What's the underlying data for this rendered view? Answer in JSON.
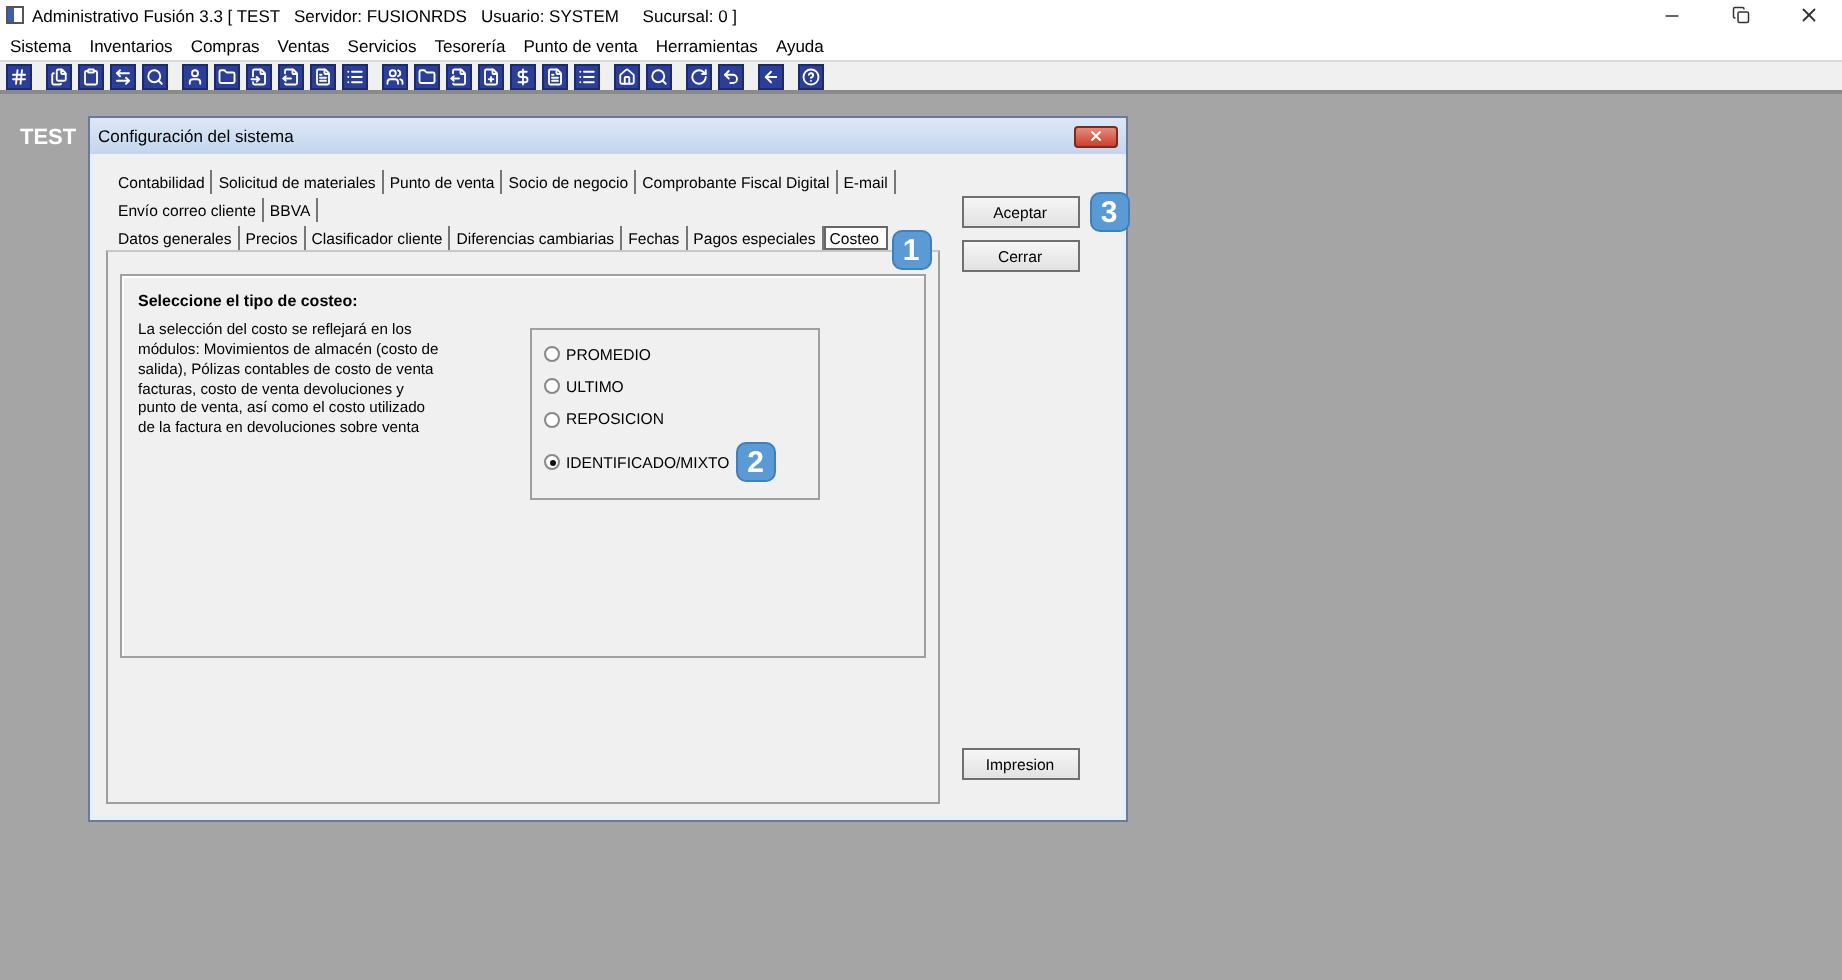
{
  "window": {
    "title": "Administrativo Fusión 3.3 [ TEST   Servidor: FUSIONRDS   Usuario: SYSTEM     Sucursal: 0 ]"
  },
  "menu": [
    "Sistema",
    "Inventarios",
    "Compras",
    "Ventas",
    "Servicios",
    "Tesorería",
    "Punto de venta",
    "Herramientas",
    "Ayuda"
  ],
  "desktop_label": "TEST",
  "dialog": {
    "title": "Configuración del sistema",
    "tab_rows": [
      [
        {
          "label": "Contabilidad",
          "selected": false
        },
        {
          "label": "Solicitud de materiales",
          "selected": false
        },
        {
          "label": "Punto de venta",
          "selected": false
        },
        {
          "label": "Socio de negocio",
          "selected": false
        },
        {
          "label": "Comprobante Fiscal Digital",
          "selected": false
        },
        {
          "label": "E-mail",
          "selected": false
        }
      ],
      [
        {
          "label": "Envío correo cliente",
          "selected": false
        },
        {
          "label": "BBVA",
          "selected": false
        }
      ],
      [
        {
          "label": "Datos generales",
          "selected": false
        },
        {
          "label": "Precios",
          "selected": false
        },
        {
          "label": "Clasificador cliente",
          "selected": false
        },
        {
          "label": "Diferencias cambiarias",
          "selected": false
        },
        {
          "label": "Fechas",
          "selected": false
        },
        {
          "label": "Pagos especiales",
          "selected": false
        },
        {
          "label": "Costeo",
          "selected": true,
          "callout": "1"
        }
      ]
    ],
    "heading": "Seleccione el tipo de costeo:",
    "description": "La selección del costo se reflejará en los módulos: Movimientos de almacén (costo de salida), Pólizas contables de costo de venta facturas, costo de venta devoluciones y punto de venta, así como el costo utilizado de la factura en devoluciones sobre venta",
    "options": [
      {
        "label": "PROMEDIO",
        "selected": false
      },
      {
        "label": "ULTIMO",
        "selected": false
      },
      {
        "label": "REPOSICION",
        "selected": false
      },
      {
        "label": "IDENTIFICADO/MIXTO",
        "selected": true,
        "callout": "2"
      }
    ],
    "buttons": [
      {
        "label": "Aceptar",
        "callout": "3"
      },
      {
        "label": "Cerrar"
      }
    ],
    "print_button": "Impresion"
  }
}
